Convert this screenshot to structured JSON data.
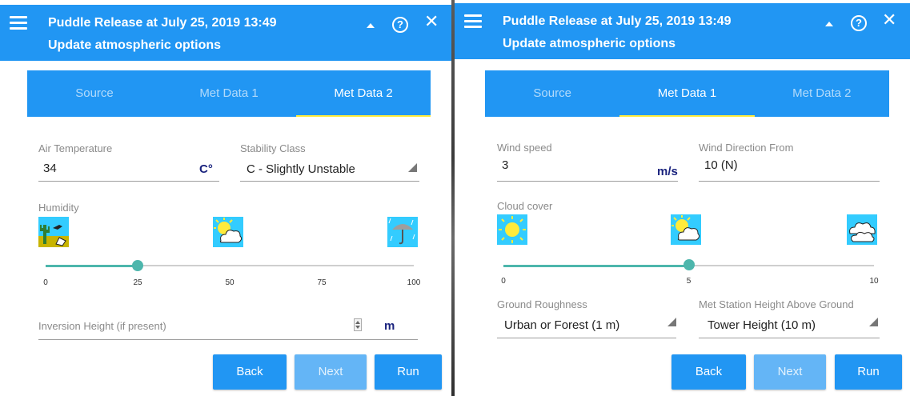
{
  "colors": {
    "header_blue": "#2196f3",
    "accent_teal": "#4db6ac",
    "tab_indicator": "#ffeb3b",
    "unit_navy": "#1a237e"
  },
  "left": {
    "header": {
      "title": "Puddle Release at July 25, 2019 13:49",
      "subtitle": "Update atmospheric options",
      "icons": [
        "menu-icon",
        "collapse-icon",
        "help-icon",
        "close-icon"
      ]
    },
    "tabs": [
      {
        "label": "Source"
      },
      {
        "label": "Met Data 1"
      },
      {
        "label": "Met Data 2",
        "active": true
      }
    ],
    "air_temperature": {
      "label": "Air Temperature",
      "value": "34",
      "unit": "C°"
    },
    "stability_class": {
      "label": "Stability Class",
      "value": "C - Slightly Unstable"
    },
    "humidity": {
      "label": "Humidity",
      "icons": [
        "dry-desert-icon",
        "partly-cloudy-icon",
        "rain-umbrella-icon"
      ],
      "ticks": [
        "0",
        "25",
        "50",
        "75",
        "100"
      ],
      "value": 25
    },
    "inversion_height": {
      "placeholder": "Inversion Height (if present)",
      "unit": "m"
    },
    "buttons": {
      "back": "Back",
      "next": "Next",
      "run": "Run"
    }
  },
  "right": {
    "header": {
      "title": "Puddle Release at July 25, 2019 13:49",
      "subtitle": "Update atmospheric options",
      "icons": [
        "menu-icon",
        "collapse-icon",
        "help-icon",
        "close-icon"
      ]
    },
    "tabs": [
      {
        "label": "Source"
      },
      {
        "label": "Met Data 1",
        "active": true
      },
      {
        "label": "Met Data 2"
      }
    ],
    "wind_speed": {
      "label": "Wind speed",
      "value": "3",
      "unit": "m/s"
    },
    "wind_direction": {
      "label": "Wind Direction From",
      "value": "10 (N)"
    },
    "cloud_cover": {
      "label": "Cloud cover",
      "icons": [
        "sunny-icon",
        "partly-cloudy-icon",
        "overcast-icon"
      ],
      "ticks": [
        "0",
        "5",
        "10"
      ],
      "value": 5
    },
    "ground_roughness": {
      "label": "Ground Roughness",
      "value": "Urban or Forest (1 m)"
    },
    "met_station_height": {
      "label": "Met Station Height Above Ground",
      "value": "Tower Height (10 m)"
    },
    "buttons": {
      "back": "Back",
      "next": "Next",
      "run": "Run"
    }
  }
}
